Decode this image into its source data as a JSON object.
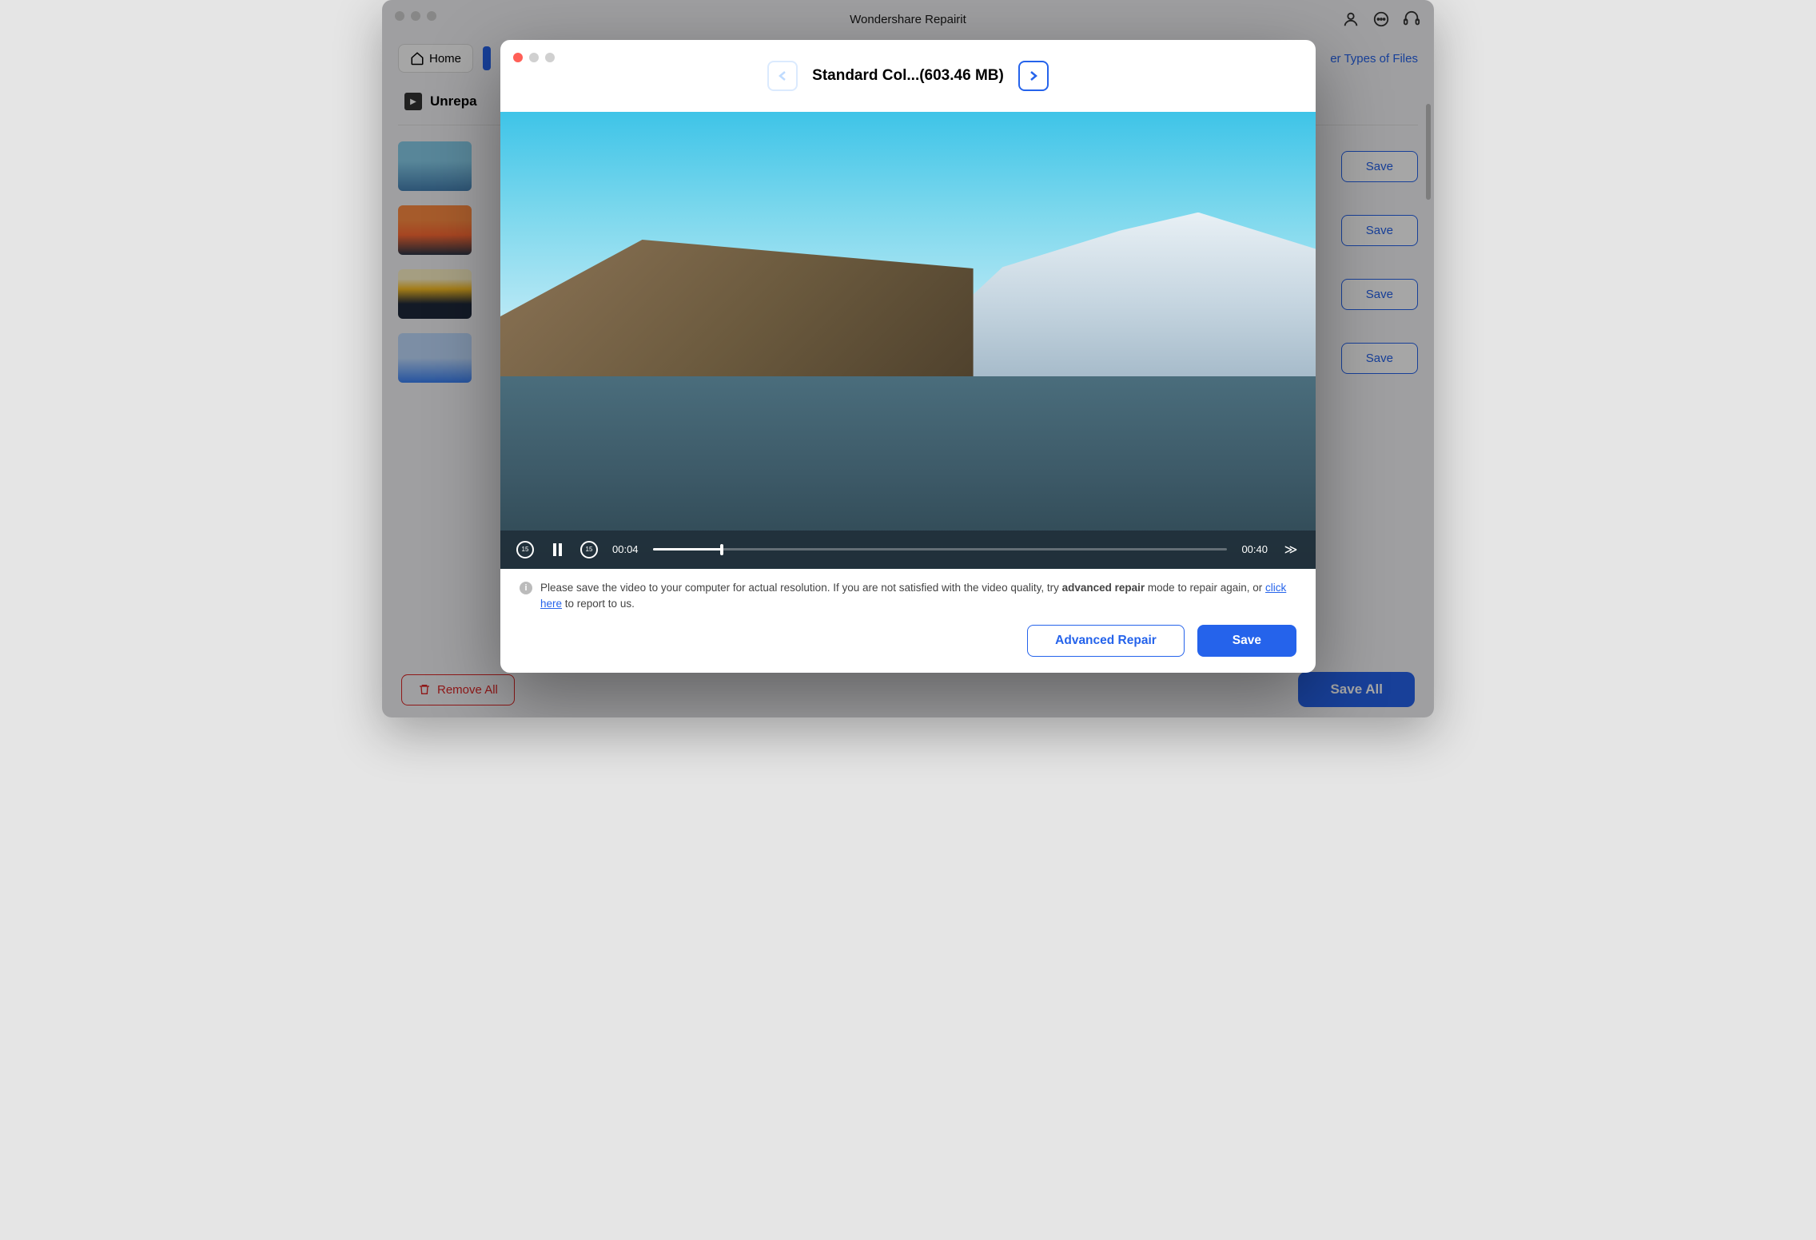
{
  "app": {
    "title": "Wondershare Repairit"
  },
  "toolbar": {
    "home_label": "Home",
    "other_types_label": "er Types of Files"
  },
  "section": {
    "title": "Unrepa"
  },
  "files": {
    "save_label": "Save"
  },
  "bottom": {
    "remove_all_label": "Remove All",
    "save_all_label": "Save All"
  },
  "preview": {
    "title": "Standard Col...(603.46 MB)",
    "current_time": "00:04",
    "total_time": "00:40",
    "info_text_1": "Please save the video to your computer for actual resolution. If you are not satisfied with the video quality, try ",
    "info_bold": "advanced repair",
    "info_text_2": " mode to repair again, or ",
    "info_link": "click here",
    "info_text_3": " to report to us.",
    "advanced_repair_label": "Advanced Repair",
    "save_label": "Save"
  }
}
